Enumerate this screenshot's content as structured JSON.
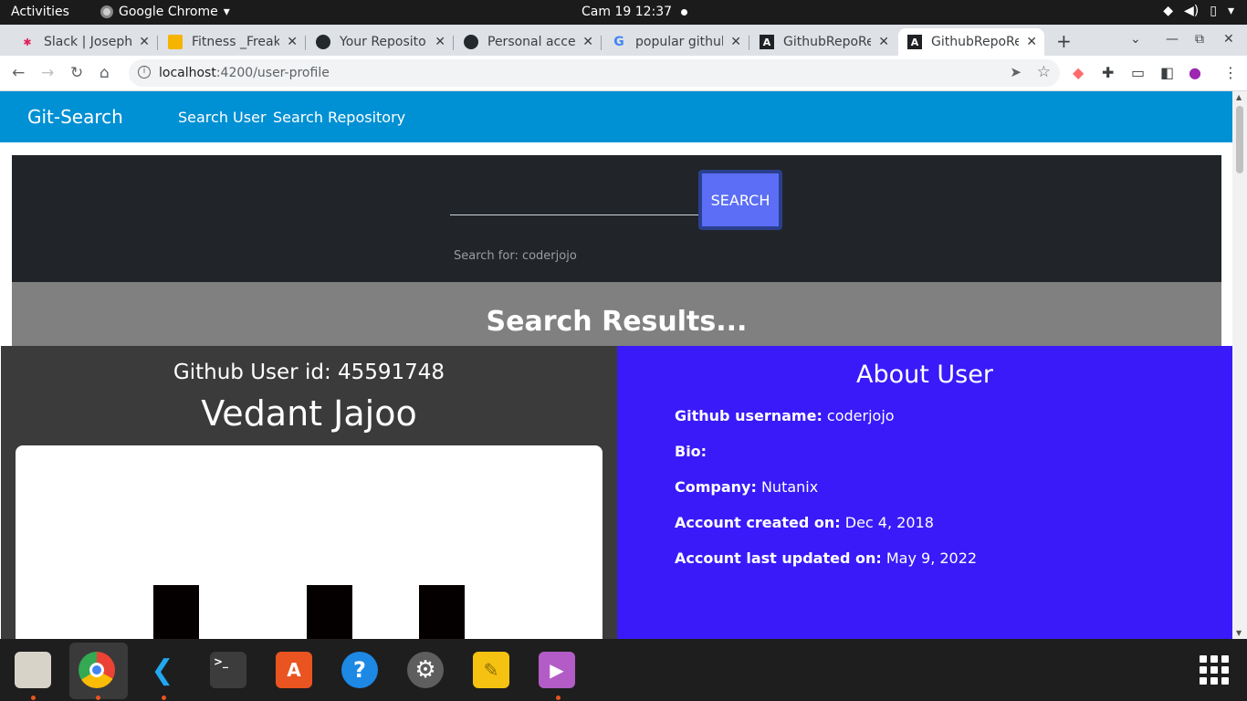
{
  "topbar": {
    "activities": "Activities",
    "app_name": "Google Chrome",
    "clock": "Cam 19  12:37"
  },
  "browser": {
    "tabs": [
      {
        "title": "Slack | Joseph",
        "icon": "slack-icon"
      },
      {
        "title": "Fitness _Freak",
        "icon": "slides-icon"
      },
      {
        "title": "Your Repositor",
        "icon": "github-icon"
      },
      {
        "title": "Personal acces",
        "icon": "github-icon"
      },
      {
        "title": "popular githul",
        "icon": "google-icon"
      },
      {
        "title": "GithubRepoRe",
        "icon": "angular-icon"
      },
      {
        "title": "GithubRepoRe",
        "icon": "angular-icon",
        "active": true
      }
    ],
    "url_host": "localhost",
    "url_path": ":4200/user-profile"
  },
  "app": {
    "brand": "Git-Search",
    "nav": [
      "Search User",
      "Search Repository"
    ],
    "search": {
      "value": "",
      "button": "SEARCH",
      "search_for": "Search for: coderjojo"
    },
    "results_heading": "Search Results...",
    "user": {
      "id_line": "Github User id: 45591748",
      "name": "Vedant Jajoo"
    },
    "about": {
      "heading": "About User",
      "rows": [
        {
          "label": "Github username:",
          "value": " coderjojo"
        },
        {
          "label": "Bio:",
          "value": ""
        },
        {
          "label": "Company:",
          "value": " Nutanix"
        },
        {
          "label": "Account created on:",
          "value": " Dec 4, 2018"
        },
        {
          "label": "Account last updated on:",
          "value": " May 9, 2022"
        }
      ]
    }
  },
  "colors": {
    "navbar": "#0090d4",
    "search_panel": "#212529",
    "search_button": "#5b6ef5",
    "results_bar": "#808080",
    "left_card": "#3b3b3b",
    "right_card": "#3a1af8"
  },
  "dock": {
    "apps": [
      "files-icon",
      "chrome-icon",
      "vscode-icon",
      "terminal-icon",
      "app-center-icon",
      "help-icon",
      "settings-icon",
      "notes-icon",
      "video-icon",
      "app-grid-icon"
    ]
  }
}
